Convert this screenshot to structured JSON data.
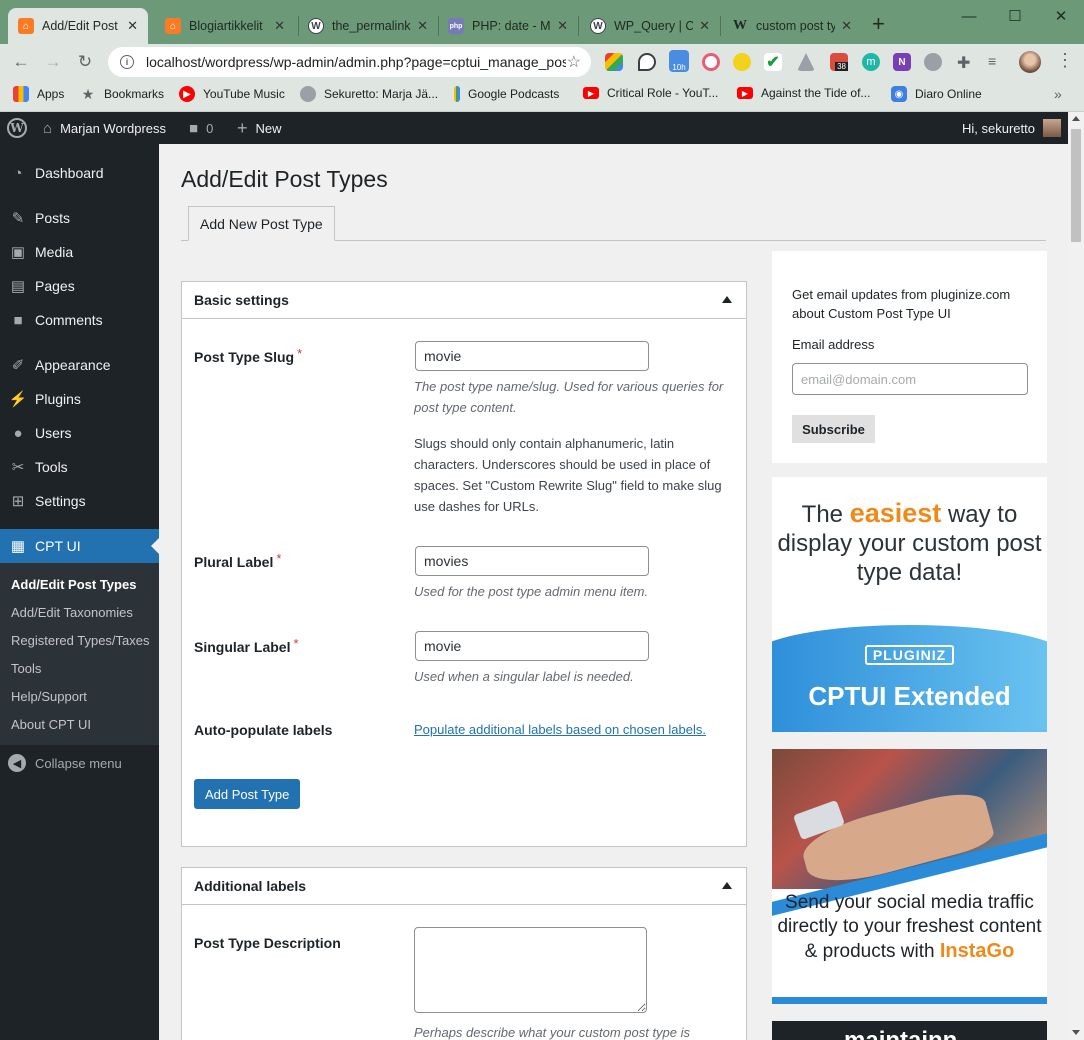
{
  "browser": {
    "tabs": [
      {
        "label": "Add/Edit Post Types",
        "icon": "xampp-favicon",
        "color": "#fb7a24",
        "glyph": "⌂"
      },
      {
        "label": "Blogiartikkelit",
        "icon": "xampp-favicon",
        "color": "#fb7a24",
        "glyph": "⌂"
      },
      {
        "label": "the_permalink",
        "icon": "wordpress-favicon",
        "color": "#3c434a",
        "glyph": "W"
      },
      {
        "label": "PHP: date - Manual",
        "icon": "php-favicon",
        "color": "#777bb3",
        "glyph": "php"
      },
      {
        "label": "WP_Query | Class",
        "icon": "wordpress-favicon",
        "color": "#3c434a",
        "glyph": "W"
      },
      {
        "label": "custom post type",
        "icon": "wikipedia-favicon",
        "color": "#ffffff",
        "glyph": "W"
      }
    ],
    "url": "localhost/wordpress/wp-admin/admin.php?page=cptui_manage_post_types",
    "bookmarks": [
      {
        "label": "Apps",
        "icon": "apps-grid-icon"
      },
      {
        "label": "Bookmarks",
        "icon": "star-icon"
      },
      {
        "label": "YouTube Music",
        "icon": "youtube-music-icon"
      },
      {
        "label": "Sekuretto: Marja Jä...",
        "icon": "globe-icon"
      },
      {
        "label": "Google Podcasts",
        "icon": "google-podcasts-icon"
      },
      {
        "label": "Critical Role - YouT...",
        "icon": "youtube-icon"
      },
      {
        "label": "Against the Tide of...",
        "icon": "youtube-icon"
      },
      {
        "label": "Diaro Online",
        "icon": "diaro-icon"
      }
    ],
    "ext_badges": {
      "timer": "10h",
      "todoist": "38"
    }
  },
  "adminbar": {
    "site_name": "Marjan Wordpress",
    "comments_count": "0",
    "new_label": "New",
    "greeting": "Hi, sekuretto"
  },
  "sidebar": {
    "items": [
      {
        "label": "Dashboard",
        "icon": "dashboard-icon"
      },
      {
        "label": "Posts",
        "icon": "pin-icon"
      },
      {
        "label": "Media",
        "icon": "media-icon"
      },
      {
        "label": "Pages",
        "icon": "pages-icon"
      },
      {
        "label": "Comments",
        "icon": "comment-icon"
      },
      {
        "label": "Appearance",
        "icon": "brush-icon"
      },
      {
        "label": "Plugins",
        "icon": "plug-icon"
      },
      {
        "label": "Users",
        "icon": "user-icon"
      },
      {
        "label": "Tools",
        "icon": "wrench-icon"
      },
      {
        "label": "Settings",
        "icon": "settings-icon"
      },
      {
        "label": "CPT UI",
        "icon": "cptui-icon"
      }
    ],
    "submenu": [
      "Add/Edit Post Types",
      "Add/Edit Taxonomies",
      "Registered Types/Taxes",
      "Tools",
      "Help/Support",
      "About CPT UI"
    ],
    "collapse_label": "Collapse menu"
  },
  "main": {
    "title": "Add/Edit Post Types",
    "tab_label": "Add New Post Type",
    "basic": {
      "heading": "Basic settings",
      "slug_label": "Post Type Slug",
      "slug_value": "movie",
      "slug_desc": "The post type name/slug. Used for various queries for post type content.",
      "slug_note": "Slugs should only contain alphanumeric, latin characters. Underscores should be used in place of spaces. Set \"Custom Rewrite Slug\" field to make slug use dashes for URLs.",
      "plural_label": "Plural Label",
      "plural_value": "movies",
      "plural_desc": "Used for the post type admin menu item.",
      "singular_label": "Singular Label",
      "singular_value": "movie",
      "singular_desc": "Used when a singular label is needed.",
      "autopop_label": "Auto-populate labels",
      "autopop_link": "Populate additional labels based on chosen labels.",
      "required_mark": "*",
      "add_button": "Add Post Type"
    },
    "additional": {
      "heading": "Additional labels",
      "desc_label": "Post Type Description",
      "desc_help": "Perhaps describe what your custom post type is"
    }
  },
  "aside": {
    "newsletter_text": "Get email updates from pluginize.com about Custom Post Type UI",
    "email_label": "Email address",
    "email_placeholder": "email@domain.com",
    "subscribe_label": "Subscribe",
    "ad1": {
      "pre": "The",
      "highlight": "easiest",
      "post": "way to display your custom post type data!",
      "brand": "PLUGINIZ",
      "product": "CPTUI Extended"
    },
    "ad2": {
      "text": "Send your social media traffic directly to your freshest content & products with",
      "highlight": "InstaGo"
    },
    "ad3": {
      "text": "maintainn"
    }
  },
  "colors": {
    "wp_dark": "#1d2327",
    "wp_blue": "#2271b1",
    "accent_orange": "#ef8a1a",
    "chrome_frame": "#6c9a78"
  }
}
